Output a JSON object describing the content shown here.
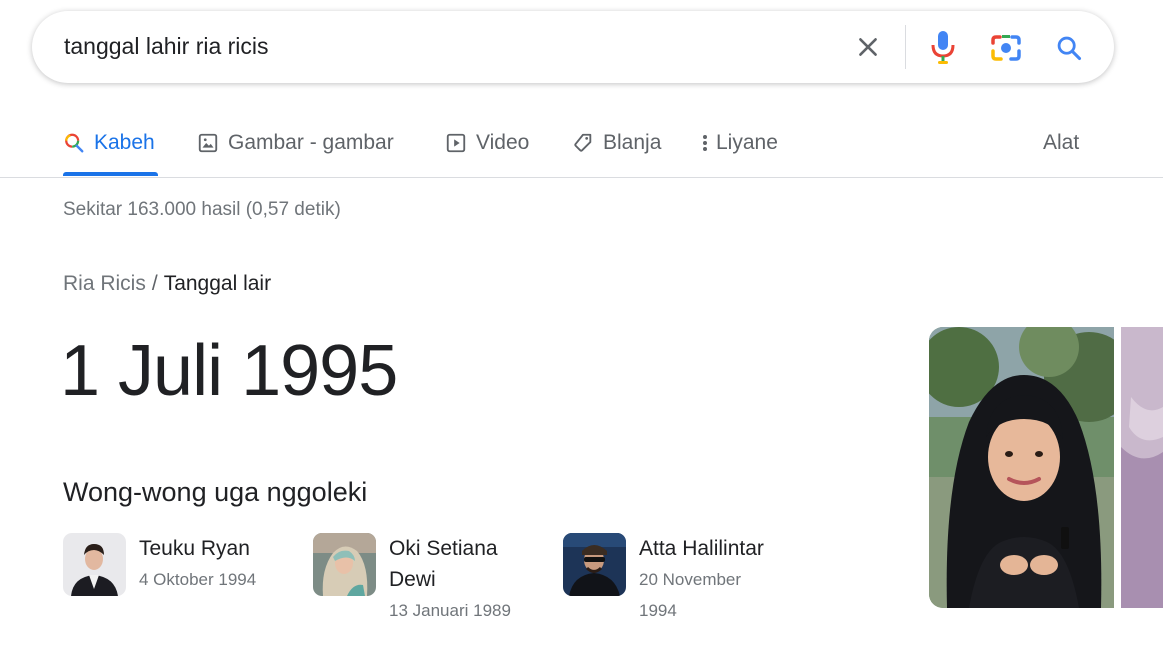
{
  "search": {
    "query": "tanggal lahir ria ricis"
  },
  "tabs": [
    {
      "label": "Kabeh",
      "icon": "search-icon",
      "active": true
    },
    {
      "label": "Gambar - gambar",
      "icon": "image-icon"
    },
    {
      "label": "Video",
      "icon": "video-icon"
    },
    {
      "label": "Blanja",
      "icon": "tag-icon"
    },
    {
      "label": "Liyane",
      "icon": "more-vert-icon"
    }
  ],
  "tools_label": "Alat",
  "result_stats": "Sekitar 163.000 hasil (0,57 detik)",
  "breadcrumb": {
    "entity": "Ria Ricis",
    "separator": "/",
    "attribute": "Tanggal lair"
  },
  "answer": "1 Juli 1995",
  "people_also_search": {
    "heading": "Wong-wong uga nggoleki",
    "people": [
      {
        "name": "Teuku Ryan",
        "date": "4 Oktober 1994"
      },
      {
        "name_line1": "Oki Setiana",
        "name_line2": "Dewi",
        "date": "13 Januari 1989"
      },
      {
        "name": "Atta Halilintar",
        "date_line1": "20 November",
        "date_line2": "1994"
      }
    ]
  },
  "colors": {
    "accent": "#1a73e8",
    "text_primary": "#202124",
    "text_secondary": "#70757a"
  }
}
